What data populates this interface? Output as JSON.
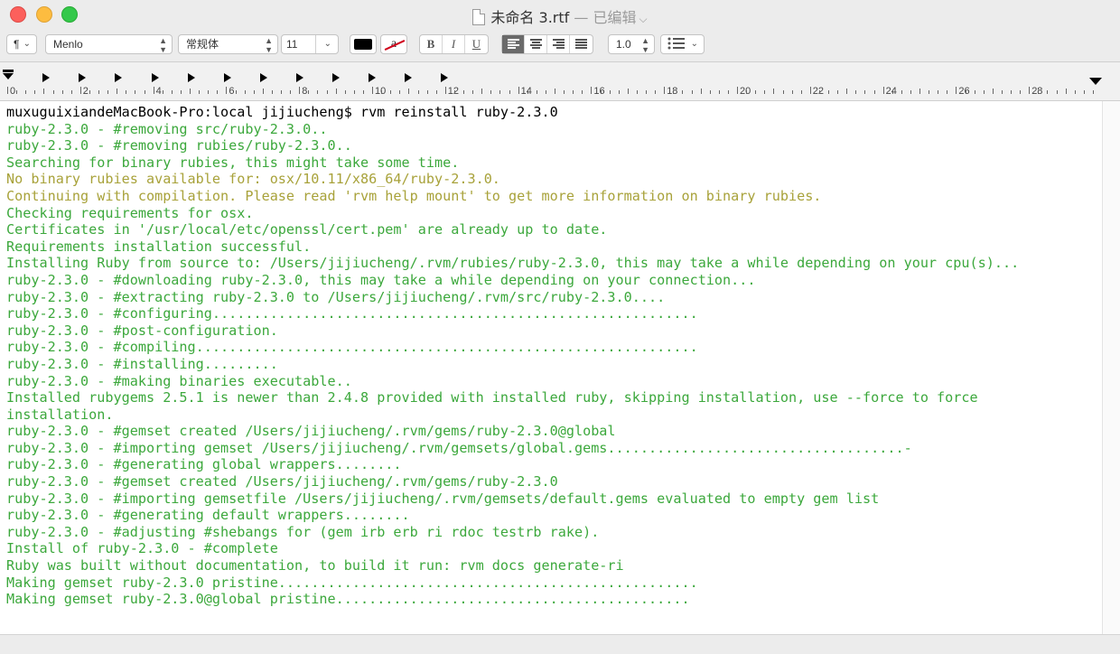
{
  "window": {
    "title": "未命名 3.rtf",
    "title_suffix": "— 已编辑",
    "title_chevron": "⌵"
  },
  "toolbar": {
    "paragraph_style": "¶",
    "font_family": "Menlo",
    "font_style": "常规体",
    "font_size": "11",
    "bold_label": "B",
    "italic_label": "I",
    "underline_label": "U",
    "line_spacing": "1.0",
    "text_color": "#000000",
    "highlight_label": "a"
  },
  "ruler": {
    "labels": [
      "0",
      "2",
      "4",
      "6",
      "8",
      "10",
      "12",
      "14",
      "16",
      "18",
      "20",
      "22",
      "24",
      "26",
      "28"
    ]
  },
  "colors": {
    "prompt": "#000000",
    "green": "#3ca83c",
    "yellow": "#a8a23a"
  },
  "document": {
    "lines": [
      {
        "text": "muxuguixiandeMacBook-Pro:local jijiucheng$ rvm reinstall ruby-2.3.0",
        "style": "prompt"
      },
      {
        "text": "ruby-2.3.0 - #removing src/ruby-2.3.0..",
        "style": "green"
      },
      {
        "text": "ruby-2.3.0 - #removing rubies/ruby-2.3.0..",
        "style": "green"
      },
      {
        "text": "Searching for binary rubies, this might take some time.",
        "style": "green"
      },
      {
        "text": "No binary rubies available for: osx/10.11/x86_64/ruby-2.3.0.",
        "style": "yellow"
      },
      {
        "text": "Continuing with compilation. Please read 'rvm help mount' to get more information on binary rubies.",
        "style": "yellow"
      },
      {
        "text": "Checking requirements for osx.",
        "style": "green"
      },
      {
        "text": "Certificates in '/usr/local/etc/openssl/cert.pem' are already up to date.",
        "style": "green"
      },
      {
        "text": "Requirements installation successful.",
        "style": "green"
      },
      {
        "text": "Installing Ruby from source to: /Users/jijiucheng/.rvm/rubies/ruby-2.3.0, this may take a while depending on your cpu(s)...",
        "style": "green"
      },
      {
        "text": "ruby-2.3.0 - #downloading ruby-2.3.0, this may take a while depending on your connection...",
        "style": "green"
      },
      {
        "text": "ruby-2.3.0 - #extracting ruby-2.3.0 to /Users/jijiucheng/.rvm/src/ruby-2.3.0....",
        "style": "green"
      },
      {
        "text": "ruby-2.3.0 - #configuring...........................................................",
        "style": "green"
      },
      {
        "text": "ruby-2.3.0 - #post-configuration.",
        "style": "green"
      },
      {
        "text": "ruby-2.3.0 - #compiling.............................................................",
        "style": "green"
      },
      {
        "text": "ruby-2.3.0 - #installing.........",
        "style": "green"
      },
      {
        "text": "ruby-2.3.0 - #making binaries executable..",
        "style": "green"
      },
      {
        "text": "Installed rubygems 2.5.1 is newer than 2.4.8 provided with installed ruby, skipping installation, use --force to force",
        "style": "green"
      },
      {
        "text": "installation.",
        "style": "green"
      },
      {
        "text": "ruby-2.3.0 - #gemset created /Users/jijiucheng/.rvm/gems/ruby-2.3.0@global",
        "style": "green"
      },
      {
        "text": "ruby-2.3.0 - #importing gemset /Users/jijiucheng/.rvm/gemsets/global.gems....................................-",
        "style": "green"
      },
      {
        "text": "ruby-2.3.0 - #generating global wrappers........",
        "style": "green"
      },
      {
        "text": "ruby-2.3.0 - #gemset created /Users/jijiucheng/.rvm/gems/ruby-2.3.0",
        "style": "green"
      },
      {
        "text": "ruby-2.3.0 - #importing gemsetfile /Users/jijiucheng/.rvm/gemsets/default.gems evaluated to empty gem list",
        "style": "green"
      },
      {
        "text": "ruby-2.3.0 - #generating default wrappers........",
        "style": "green"
      },
      {
        "text": "ruby-2.3.0 - #adjusting #shebangs for (gem irb erb ri rdoc testrb rake).",
        "style": "green"
      },
      {
        "text": "Install of ruby-2.3.0 - #complete",
        "style": "green"
      },
      {
        "text": "Ruby was built without documentation, to build it run: rvm docs generate-ri",
        "style": "green"
      },
      {
        "text": "Making gemset ruby-2.3.0 pristine...................................................",
        "style": "green"
      },
      {
        "text": "Making gemset ruby-2.3.0@global pristine...........................................",
        "style": "green"
      }
    ]
  }
}
